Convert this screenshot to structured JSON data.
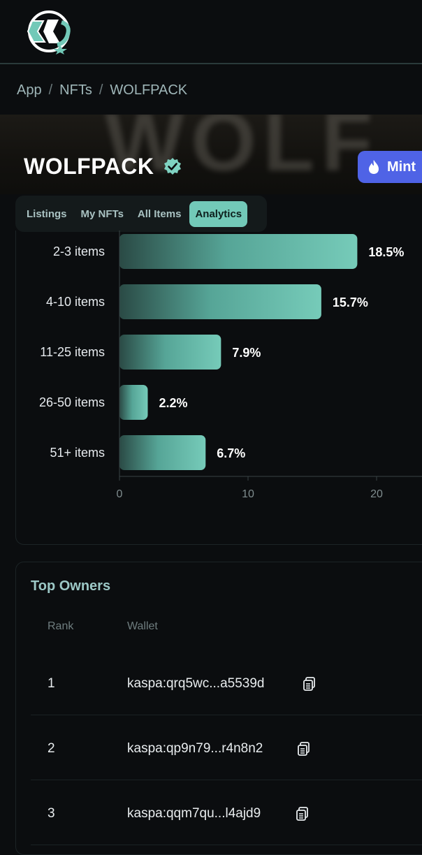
{
  "header": {
    "logo_name": "skc-logo"
  },
  "breadcrumb": {
    "items": [
      "App",
      "NFTs",
      "WOLFPACK"
    ],
    "separator": "/"
  },
  "banner": {
    "background_text": "WOLF"
  },
  "collection": {
    "title": "WOLFPACK",
    "verified": true,
    "mint_label": "Mint"
  },
  "tabs": [
    {
      "label": "Listings",
      "active": false
    },
    {
      "label": "My NFTs",
      "active": false
    },
    {
      "label": "All Items",
      "active": false
    },
    {
      "label": "Analytics",
      "active": true
    }
  ],
  "chart_data": {
    "type": "bar",
    "orientation": "horizontal",
    "categories": [
      "2-3 items",
      "4-10 items",
      "11-25 items",
      "26-50 items",
      "51+ items"
    ],
    "values": [
      18.5,
      15.7,
      7.9,
      2.2,
      6.7
    ],
    "value_labels": [
      "18.5%",
      "15.7%",
      "7.9%",
      "2.2%",
      "6.7%"
    ],
    "x_ticks": [
      0,
      10,
      20
    ],
    "xlim": [
      0,
      20
    ]
  },
  "owners": {
    "title": "Top Owners",
    "columns": [
      "Rank",
      "Wallet"
    ],
    "rows": [
      {
        "rank": "1",
        "wallet": "kaspa:qrq5wc...a5539d"
      },
      {
        "rank": "2",
        "wallet": "kaspa:qp9n79...r4n8n2"
      },
      {
        "rank": "3",
        "wallet": "kaspa:qqm7qu...l4ajd9"
      }
    ]
  },
  "colors": {
    "accent": "#72c9b8",
    "mint": "#4f63e6",
    "background": "#0b0d0f"
  }
}
